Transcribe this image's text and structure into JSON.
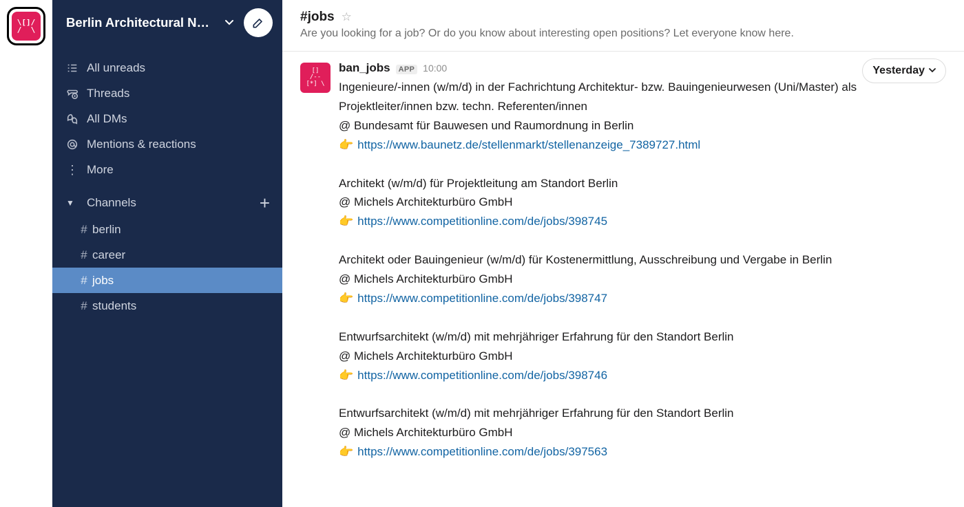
{
  "workspace": {
    "name": "Berlin Architectural N…",
    "logo_text": "\\[]/\n/ \\"
  },
  "sidebar": {
    "items": [
      {
        "id": "all-unreads",
        "label": "All unreads",
        "icon": "list"
      },
      {
        "id": "threads",
        "label": "Threads",
        "icon": "threads"
      },
      {
        "id": "all-dms",
        "label": "All DMs",
        "icon": "dms"
      },
      {
        "id": "mentions",
        "label": "Mentions & reactions",
        "icon": "mention"
      },
      {
        "id": "more",
        "label": "More",
        "icon": "dots"
      }
    ],
    "channels_header": "Channels",
    "channels": [
      {
        "name": "berlin",
        "active": false
      },
      {
        "name": "career",
        "active": false
      },
      {
        "name": "jobs",
        "active": true
      },
      {
        "name": "students",
        "active": false
      }
    ]
  },
  "channel_header": {
    "title": "#jobs",
    "description": "Are you looking for a job? Or do you know about interesting open positions? Let everyone know here."
  },
  "date_pill": "Yesterday",
  "message": {
    "author": "ban_jobs",
    "badge": "APP",
    "time": "10:00",
    "posts": [
      {
        "title": "Ingenieure/-innen (w/m/d) in der Fachrichtung Architektur- bzw. Bauingenieurwesen (Uni/Master) als Projektleiter/innen bzw. techn. Referenten/innen",
        "at": "@ Bundesamt für Bauwesen und Raumordnung in Berlin",
        "url": "https://www.baunetz.de/stellenmarkt/stellenanzeige_7389727.html"
      },
      {
        "title": "Architekt (w/m/d) für Projektleitung am Standort Berlin",
        "at": "@ Michels Architekturbüro GmbH",
        "url": "https://www.competitionline.com/de/jobs/398745"
      },
      {
        "title": "Architekt oder Bauingenieur (w/m/d) für Kostenermittlung, Ausschreibung und Vergabe in Berlin",
        "at": "@ Michels Architekturbüro GmbH",
        "url": "https://www.competitionline.com/de/jobs/398747"
      },
      {
        "title": "Entwurfsarchitekt (w/m/d) mit mehrjähriger Erfahrung für den Standort Berlin",
        "at": "@ Michels Architekturbüro GmbH",
        "url": "https://www.competitionline.com/de/jobs/398746"
      },
      {
        "title": "Entwurfsarchitekt (w/m/d) mit mehrjähriger Erfahrung für den Standort Berlin",
        "at": "@ Michels Architekturbüro GmbH",
        "url": "https://www.competitionline.com/de/jobs/397563"
      }
    ]
  }
}
